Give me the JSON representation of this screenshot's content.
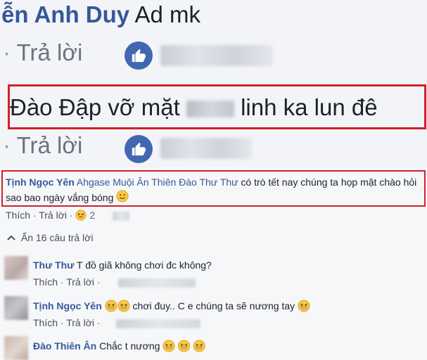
{
  "top_comment": {
    "author_partial": "ễn Anh Duy",
    "text": "Ad mk",
    "reply_label": "Trả lời",
    "separator": "·"
  },
  "highlight_comment": {
    "author": "Đào",
    "text_before": "Đập vỡ mặt",
    "text_after": "linh ka lun đê",
    "reply_label": "Trả lời",
    "separator": "·"
  },
  "main_comment": {
    "author": "Tịnh Ngọc Yên",
    "tags": "Ahgase Muội Ân Thiên Đào Thư Thư",
    "text": "có trò tết nay chúng ta họp mặt chào hỏi sao bao ngày vắng bóng",
    "like_label": "Thích",
    "reply_label": "Trả lời",
    "separator": "·",
    "reaction_count": "2"
  },
  "replies_toggle": {
    "label": "Ẩn 16 câu trả lời"
  },
  "replies": [
    {
      "author": "Thư Thư",
      "text": "T đồ giã không chơi đc không?",
      "like_label": "Thích",
      "reply_label": "Trả lời",
      "separator": "·"
    },
    {
      "author": "Tịnh Ngọc Yên",
      "text": "chơi đuy.. C e chúng ta sẽ nương tay",
      "like_label": "Thích",
      "reply_label": "Trả lời",
      "separator": "·"
    },
    {
      "author": "Đào Thiên Ân",
      "text": "Chắc t nương"
    }
  ],
  "colors": {
    "link_blue": "#365899",
    "like_blue": "#4267b2",
    "highlight_red": "#d0212b",
    "meta_gray": "#8d949e"
  },
  "icons": [
    "like-thumb-icon",
    "smile-emoji-icon",
    "laughing-emoji-icon",
    "squint-laugh-emoji-icon",
    "chevron-up-icon"
  ]
}
